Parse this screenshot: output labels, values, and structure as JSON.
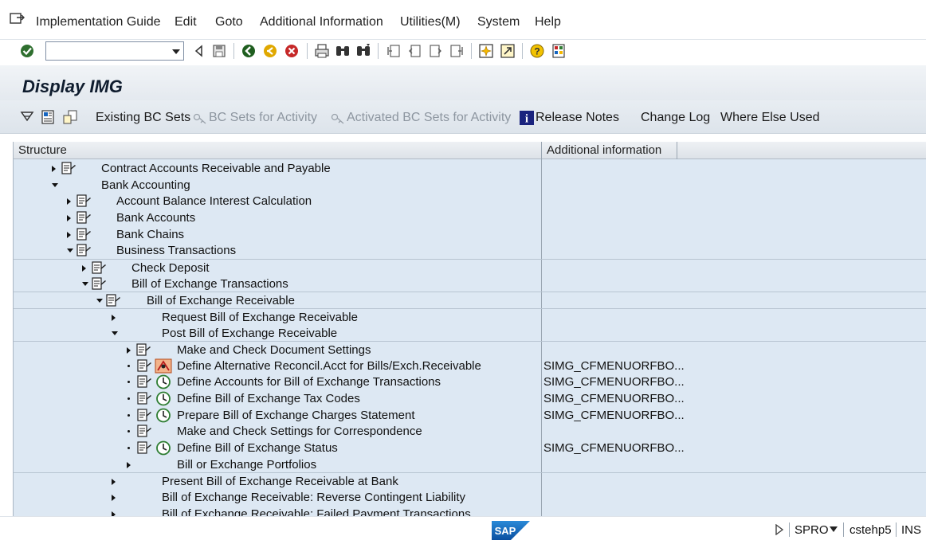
{
  "menu": {
    "items": [
      "Implementation Guide",
      "Edit",
      "Goto",
      "Additional Information",
      "Utilities(M)",
      "System",
      "Help"
    ]
  },
  "toolbar": {
    "command_field_value": "",
    "icons": [
      "enter-check-icon",
      "back-icon",
      "save-icon",
      "back-green-icon",
      "exit-icon",
      "cancel-icon",
      "print-icon",
      "find-icon",
      "find-next-icon",
      "first-page-icon",
      "previous-page-icon",
      "next-page-icon",
      "last-page-icon",
      "create-session-icon",
      "shortcut-icon",
      "help-icon",
      "layout-icon"
    ]
  },
  "title": "Display IMG",
  "app_toolbar": {
    "existing_bc_sets": "Existing BC Sets",
    "bc_sets_for_activity": "BC Sets for Activity",
    "activated_bc_sets": "Activated BC Sets for Activity",
    "release_notes": "Release Notes",
    "change_log": "Change Log",
    "where_else_used": "Where Else Used"
  },
  "tree": {
    "columns": [
      "Structure",
      "Additional information"
    ],
    "rows": [
      {
        "label": "Contract Accounts Receivable and Payable",
        "info": ""
      },
      {
        "label": "Bank Accounting",
        "info": ""
      },
      {
        "label": "Account Balance Interest Calculation",
        "info": ""
      },
      {
        "label": "Bank Accounts",
        "info": ""
      },
      {
        "label": "Bank Chains",
        "info": ""
      },
      {
        "label": "Business Transactions",
        "info": ""
      },
      {
        "label": "Check Deposit",
        "info": ""
      },
      {
        "label": "Bill of Exchange Transactions",
        "info": ""
      },
      {
        "label": "Bill of Exchange Receivable",
        "info": ""
      },
      {
        "label": "Request Bill of Exchange Receivable",
        "info": ""
      },
      {
        "label": "Post Bill of Exchange Receivable",
        "info": ""
      },
      {
        "label": "Make and Check Document Settings",
        "info": ""
      },
      {
        "label": "Define Alternative Reconcil.Acct for Bills/Exch.Receivable",
        "info": "SIMG_CFMENUORFBO..."
      },
      {
        "label": "Define Accounts for Bill of Exchange Transactions",
        "info": "SIMG_CFMENUORFBO..."
      },
      {
        "label": "Define Bill of Exchange Tax Codes",
        "info": "SIMG_CFMENUORFBO..."
      },
      {
        "label": "Prepare Bill of Exchange Charges Statement",
        "info": "SIMG_CFMENUORFBO..."
      },
      {
        "label": "Make and Check Settings for Correspondence",
        "info": ""
      },
      {
        "label": "Define Bill of Exchange Status",
        "info": "SIMG_CFMENUORFBO..."
      },
      {
        "label": "Bill or Exchange Portfolios",
        "info": ""
      },
      {
        "label": "Present Bill of Exchange Receivable at Bank",
        "info": ""
      },
      {
        "label": "Bill of Exchange Receivable: Reverse Contingent Liability",
        "info": ""
      },
      {
        "label": "Bill of Exchange Receivable: Failed Payment Transactions",
        "info": ""
      }
    ]
  },
  "status": {
    "transaction": "SPRO",
    "server": "cstehp5",
    "mode": "INS"
  }
}
